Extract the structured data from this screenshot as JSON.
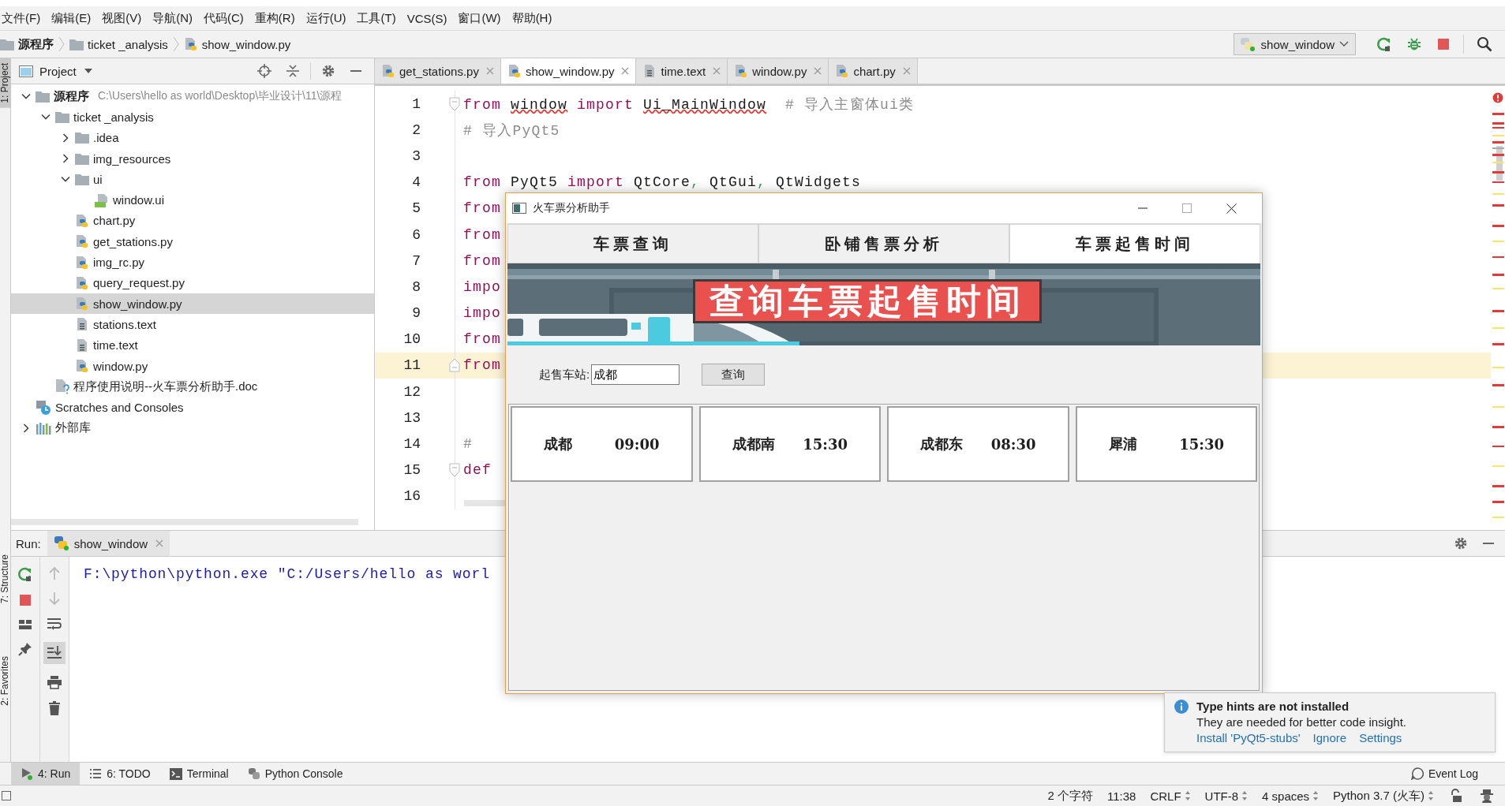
{
  "menu": [
    "文件(F)",
    "编辑(E)",
    "视图(V)",
    "导航(N)",
    "代码(C)",
    "重构(R)",
    "运行(U)",
    "工具(T)",
    "VCS(S)",
    "窗口(W)",
    "帮助(H)"
  ],
  "breadcrumb": [
    {
      "label": "源程序",
      "kind": "root"
    },
    {
      "label": "ticket _analysis",
      "kind": "folder"
    },
    {
      "label": "show_window.py",
      "kind": "python"
    }
  ],
  "run_config": {
    "label": "show_window"
  },
  "left_stripe": [
    {
      "label": "1: Project",
      "selected": true
    },
    {
      "label": "7: Structure",
      "selected": false
    },
    {
      "label": "2: Favorites",
      "selected": false
    }
  ],
  "project": {
    "title": "Project",
    "tree": [
      {
        "label": "源程序",
        "kind": "root",
        "path": "C:\\Users\\hello as world\\Desktop\\毕业设计\\11\\源程",
        "expanded": true,
        "selected": false,
        "children": [
          {
            "label": "ticket _analysis",
            "kind": "folder",
            "expanded": true,
            "selected": false,
            "children": [
              {
                "label": ".idea",
                "kind": "folder",
                "expanded": false,
                "selected": false
              },
              {
                "label": "img_resources",
                "kind": "folder",
                "expanded": false,
                "selected": false
              },
              {
                "label": "ui",
                "kind": "folder",
                "expanded": true,
                "selected": false,
                "children": [
                  {
                    "label": "window.ui",
                    "kind": "qt",
                    "selected": false
                  }
                ]
              },
              {
                "label": "chart.py",
                "kind": "python",
                "selected": false
              },
              {
                "label": "get_stations.py",
                "kind": "python",
                "selected": false
              },
              {
                "label": "img_rc.py",
                "kind": "python",
                "selected": false
              },
              {
                "label": "query_request.py",
                "kind": "python",
                "selected": false
              },
              {
                "label": "show_window.py",
                "kind": "python",
                "selected": true
              },
              {
                "label": "stations.text",
                "kind": "text",
                "selected": false
              },
              {
                "label": "time.text",
                "kind": "text",
                "selected": false
              },
              {
                "label": "window.py",
                "kind": "python",
                "selected": false
              }
            ]
          },
          {
            "label": "程序使用说明--火车票分析助手.doc",
            "kind": "doc",
            "selected": false
          }
        ]
      },
      {
        "label": "Scratches and Consoles",
        "kind": "scratches",
        "selected": false
      },
      {
        "label": "外部库",
        "kind": "library",
        "expanded": false,
        "selected": false
      }
    ]
  },
  "editor": {
    "tabs": [
      {
        "label": "get_stations.py",
        "kind": "python",
        "selected": false
      },
      {
        "label": "show_window.py",
        "kind": "python",
        "selected": true
      },
      {
        "label": "time.text",
        "kind": "text",
        "selected": false
      },
      {
        "label": "window.py",
        "kind": "python",
        "selected": false
      },
      {
        "label": "chart.py",
        "kind": "python",
        "selected": false
      }
    ],
    "lines": [
      {
        "number": "1",
        "current": false,
        "kind": "fold_start",
        "tokens": [
          {
            "text": "from ",
            "kind": "kw"
          },
          {
            "text": "window",
            "kind": "warn"
          },
          {
            "text": " import ",
            "kind": "kw"
          },
          {
            "text": "Ui_MainWindow",
            "kind": "warn"
          },
          {
            "text": "  # 导入主窗体ui类",
            "kind": "comment"
          }
        ]
      },
      {
        "number": "2",
        "current": false,
        "kind": "plain",
        "tokens": [
          {
            "text": "# 导入PyQt5",
            "kind": "comment"
          }
        ]
      },
      {
        "number": "3",
        "current": false,
        "kind": "plain"
      },
      {
        "number": "4",
        "current": false,
        "kind": "plain",
        "tokens": [
          {
            "text": "from ",
            "kind": "kw"
          },
          {
            "text": "PyQt5 ",
            "kind": "plain"
          },
          {
            "text": "import ",
            "kind": "kw"
          },
          {
            "text": "QtCore",
            "kind": "plain"
          },
          {
            "text": ", ",
            "kind": "punct"
          },
          {
            "text": "QtGui",
            "kind": "plain"
          },
          {
            "text": ", ",
            "kind": "punct"
          },
          {
            "text": "QtWidgets",
            "kind": "plain"
          }
        ]
      },
      {
        "number": "5",
        "current": false,
        "kind": "plain",
        "tokens": [
          {
            "text": "from",
            "kind": "kw"
          }
        ]
      },
      {
        "number": "6",
        "current": false,
        "kind": "plain",
        "tokens": [
          {
            "text": "from",
            "kind": "kw"
          }
        ]
      },
      {
        "number": "7",
        "current": false,
        "kind": "plain",
        "tokens": [
          {
            "text": "from",
            "kind": "kw"
          }
        ]
      },
      {
        "number": "8",
        "current": false,
        "kind": "plain",
        "tokens": [
          {
            "text": "impo",
            "kind": "kw"
          }
        ]
      },
      {
        "number": "9",
        "current": false,
        "kind": "plain",
        "tokens": [
          {
            "text": "impo",
            "kind": "kw"
          }
        ]
      },
      {
        "number": "10",
        "current": false,
        "kind": "plain",
        "tokens": [
          {
            "text": "from",
            "kind": "kw"
          }
        ]
      },
      {
        "number": "11",
        "current": true,
        "kind": "fold_end",
        "tokens": [
          {
            "text": "from",
            "kind": "kw"
          }
        ]
      },
      {
        "number": "12",
        "current": false,
        "kind": "plain"
      },
      {
        "number": "13",
        "current": false,
        "kind": "plain"
      },
      {
        "number": "14",
        "current": false,
        "kind": "plain",
        "tokens": [
          {
            "text": "#",
            "kind": "comment"
          }
        ]
      },
      {
        "number": "15",
        "current": false,
        "kind": "fold_start",
        "tokens": [
          {
            "text": "def",
            "kind": "kw"
          }
        ]
      },
      {
        "number": "16",
        "current": false,
        "kind": "plain"
      }
    ]
  },
  "dialog": {
    "title": "火车票分析助手",
    "tabs": [
      {
        "label": "车票查询",
        "selected": false
      },
      {
        "label": "卧铺售票分析",
        "selected": false
      },
      {
        "label": "车票起售时间",
        "selected": true
      }
    ],
    "banner": {
      "title": "查询车票起售时间"
    },
    "station_label": "起售车站:",
    "station_value": "成都",
    "query_button": "查询",
    "results": [
      {
        "station": "成都",
        "time": "09:00"
      },
      {
        "station": "成都南",
        "time": "15:30"
      },
      {
        "station": "成都东",
        "time": "08:30"
      },
      {
        "station": "犀浦",
        "time": "15:30"
      }
    ]
  },
  "run": {
    "label": "Run:",
    "tab": "show_window",
    "output": "F:\\python\\python.exe \"C:/Users/hello as worl"
  },
  "tool_tabs": [
    {
      "label": "4: Run",
      "kind": "run",
      "selected": true
    },
    {
      "label": "6: TODO",
      "kind": "todo",
      "selected": false
    },
    {
      "label": "Terminal",
      "kind": "terminal",
      "selected": false
    },
    {
      "label": "Python Console",
      "kind": "console",
      "selected": false
    }
  ],
  "event_log": "Event Log",
  "notification": {
    "title": "Type hints are not installed",
    "body": "They are needed for better code insight.",
    "actions": [
      "Install 'PyQt5-stubs'",
      "Ignore",
      "Settings"
    ]
  },
  "status": [
    {
      "text": "2 个字符",
      "dropdown": false
    },
    {
      "text": "11:38",
      "dropdown": false
    },
    {
      "text": "CRLF",
      "dropdown": true
    },
    {
      "text": "UTF-8",
      "dropdown": true
    },
    {
      "text": "4 spaces",
      "dropdown": true
    },
    {
      "text": "Python 3.7 (火车)",
      "dropdown": true
    }
  ]
}
